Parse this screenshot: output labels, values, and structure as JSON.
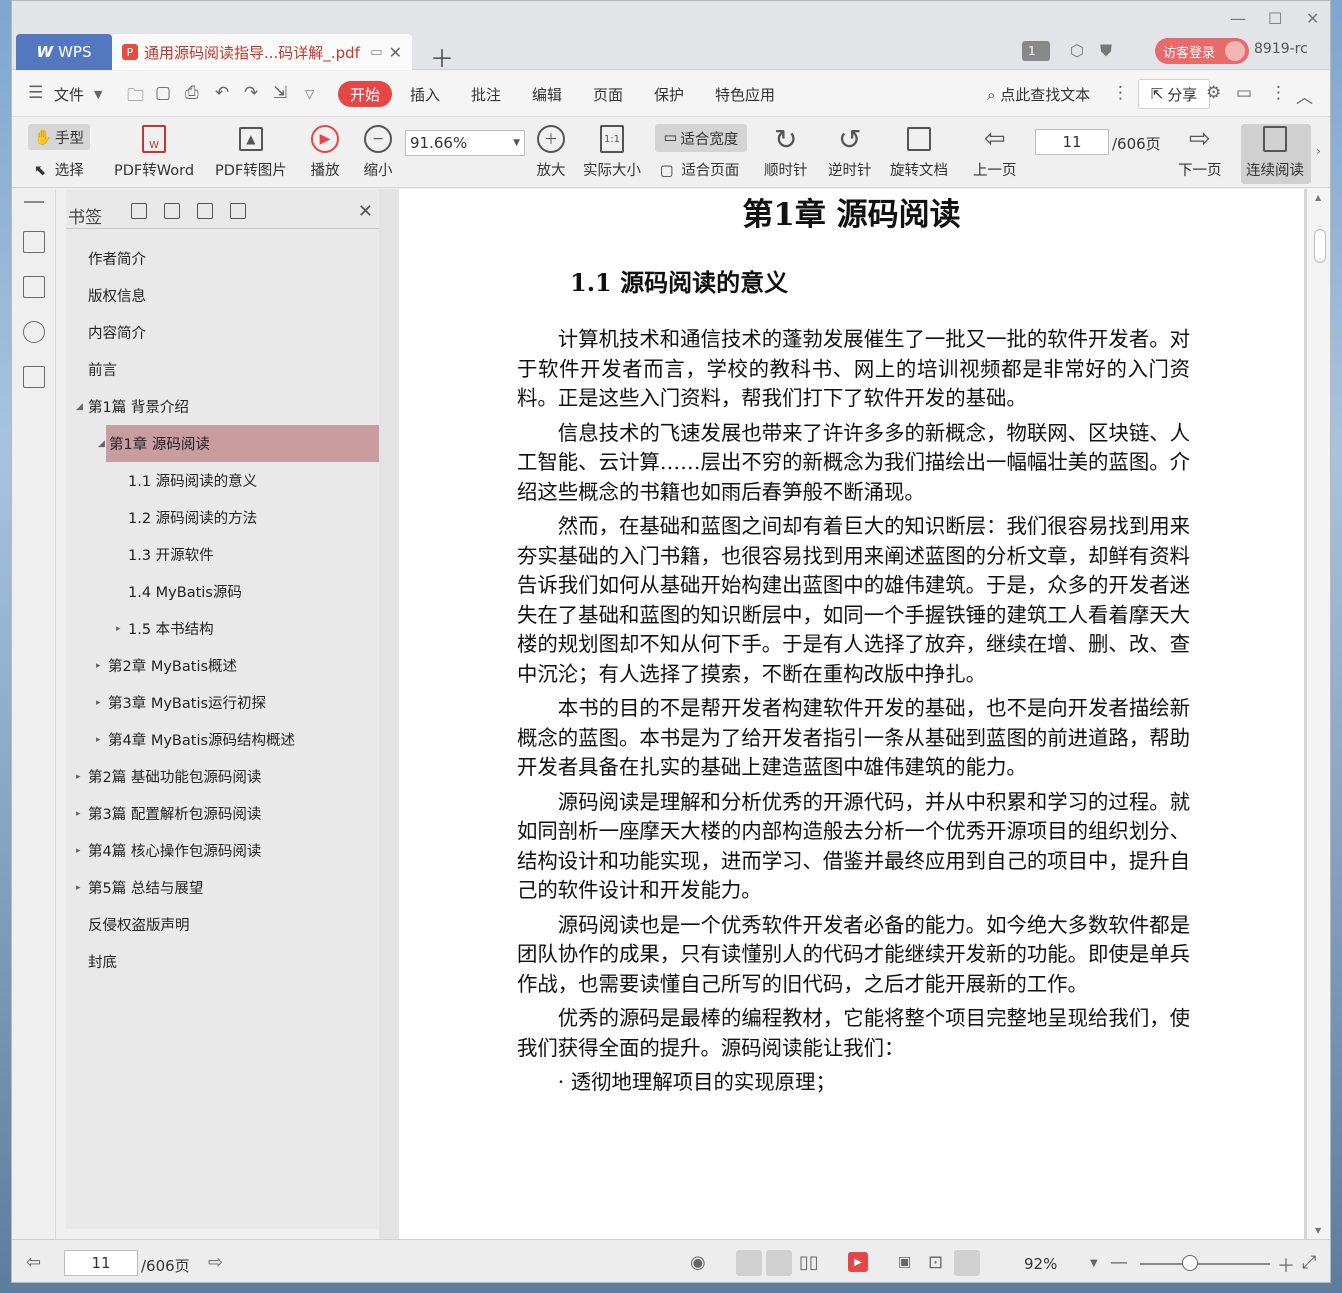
{
  "tabs": {
    "app_label": "WPS",
    "app_logo": "W",
    "doc_title": "通用源码阅读指导...码详解_.pdf",
    "doc_icon": "P",
    "window_count": "1",
    "visitor_label": "访客登录",
    "version": "8919-rc"
  },
  "menu": {
    "file": "文件",
    "items": [
      "开始",
      "插入",
      "批注",
      "编辑",
      "页面",
      "保护",
      "特色应用"
    ],
    "search": "点此查找文本",
    "share": "分享"
  },
  "toolbar": {
    "hand": "手型",
    "select": "选择",
    "pdf_to_word": "PDF转Word",
    "pdf_to_image": "PDF转图片",
    "play": "播放",
    "zoom_out": "缩小",
    "zoom_value": "91.66%",
    "zoom_in": "放大",
    "actual_size": "实际大小",
    "fit_width": "适合宽度",
    "fit_page": "适合页面",
    "clockwise": "顺时针",
    "counter_clockwise": "逆时针",
    "rotate_doc": "旋转文档",
    "prev_page": "上一页",
    "page_current": "11",
    "page_total": "/606页",
    "next_page": "下一页",
    "continuous": "连续阅读",
    "actual_size_icon": "1:1"
  },
  "bookmarks": {
    "title": "书签",
    "items": [
      {
        "label": "作者简介",
        "level": 0,
        "arrow": ""
      },
      {
        "label": "版权信息",
        "level": 0,
        "arrow": ""
      },
      {
        "label": "内容简介",
        "level": 0,
        "arrow": ""
      },
      {
        "label": "前言",
        "level": 0,
        "arrow": ""
      },
      {
        "label": "第1篇 背景介绍",
        "level": 0,
        "arrow": "◢"
      },
      {
        "label": "第1章 源码阅读",
        "level": 1,
        "arrow": "◢",
        "selected": true
      },
      {
        "label": "1.1 源码阅读的意义",
        "level": 2,
        "arrow": ""
      },
      {
        "label": "1.2 源码阅读的方法",
        "level": 2,
        "arrow": ""
      },
      {
        "label": "1.3 开源软件",
        "level": 2,
        "arrow": ""
      },
      {
        "label": "1.4 MyBatis源码",
        "level": 2,
        "arrow": ""
      },
      {
        "label": "1.5 本书结构",
        "level": 2,
        "arrow": "▸"
      },
      {
        "label": "第2章 MyBatis概述",
        "level": 1,
        "arrow": "▸"
      },
      {
        "label": "第3章 MyBatis运行初探",
        "level": 1,
        "arrow": "▸"
      },
      {
        "label": "第4章 MyBatis源码结构概述",
        "level": 1,
        "arrow": "▸"
      },
      {
        "label": "第2篇 基础功能包源码阅读",
        "level": 0,
        "arrow": "▸"
      },
      {
        "label": "第3篇 配置解析包源码阅读",
        "level": 0,
        "arrow": "▸"
      },
      {
        "label": "第4篇 核心操作包源码阅读",
        "level": 0,
        "arrow": "▸"
      },
      {
        "label": "第5篇 总结与展望",
        "level": 0,
        "arrow": "▸"
      },
      {
        "label": "反侵权盗版声明",
        "level": 0,
        "arrow": ""
      },
      {
        "label": "封底",
        "level": 0,
        "arrow": ""
      }
    ]
  },
  "document": {
    "chapter_title": "第1章 源码阅读",
    "section_title": "1.1 源码阅读的意义",
    "paragraphs": [
      "计算机技术和通信技术的蓬勃发展催生了一批又一批的软件开发者。对于软件开发者而言，学校的教科书、网上的培训视频都是非常好的入门资料。正是这些入门资料，帮我们打下了软件开发的基础。",
      "信息技术的飞速发展也带来了许许多多的新概念，物联网、区块链、人工智能、云计算……层出不穷的新概念为我们描绘出一幅幅壮美的蓝图。介绍这些概念的书籍也如雨后春笋般不断涌现。",
      "然而，在基础和蓝图之间却有着巨大的知识断层：我们很容易找到用来夯实基础的入门书籍，也很容易找到用来阐述蓝图的分析文章，却鲜有资料告诉我们如何从基础开始构建出蓝图中的雄伟建筑。于是，众多的开发者迷失在了基础和蓝图的知识断层中，如同一个手握铁锤的建筑工人看着摩天大楼的规划图却不知从何下手。于是有人选择了放弃，继续在增、删、改、查中沉沦；有人选择了摸索，不断在重构改版中挣扎。",
      "本书的目的不是帮开发者构建软件开发的基础，也不是向开发者描绘新概念的蓝图。本书是为了给开发者指引一条从基础到蓝图的前进道路，帮助开发者具备在扎实的基础上建造蓝图中雄伟建筑的能力。",
      "源码阅读是理解和分析优秀的开源代码，并从中积累和学习的过程。就如同剖析一座摩天大楼的内部构造般去分析一个优秀开源项目的组织划分、结构设计和功能实现，进而学习、借鉴并最终应用到自己的项目中，提升自己的软件设计和开发能力。",
      "源码阅读也是一个优秀软件开发者必备的能力。如今绝大多数软件都是团队协作的成果，只有读懂别人的代码才能继续开发新的功能。即使是单兵作战，也需要读懂自己所写的旧代码，之后才能开展新的工作。",
      "优秀的源码是最棒的编程教材，它能将整个项目完整地呈现给我们，使我们获得全面的提升。源码阅读能让我们：",
      "· 透彻地理解项目的实现原理；"
    ]
  },
  "statusbar": {
    "page_current": "11",
    "page_total": "/606页",
    "zoom": "92%"
  },
  "colors": {
    "accent": "#e64646",
    "wps_tab": "#5478bf",
    "bookmark_selected": "#c89ca0"
  }
}
